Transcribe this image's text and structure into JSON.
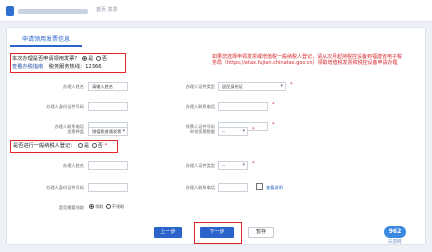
{
  "header": {
    "blurred_site_name": "",
    "subtitle": "首页 发票"
  },
  "tab": {
    "label": "申请领用发票信息"
  },
  "question_local_purchase": {
    "prefix": "本次办理是否申请领用发票？",
    "yes": "是",
    "no": "否",
    "yes_selected": true,
    "blurred_label": "查看办税指南",
    "hotline": "税务服务热线：12366"
  },
  "notice": "如果您选择申领发票或增值税一般纳税人登记，请从次月起持税控设备到福建省电子税务局（https://etax.fujian.chinatax.gov.cn）领取增值税发票和税控设备申请办理",
  "form_top": {
    "row1": {
      "label": "办理人姓名",
      "value": "请输入姓名",
      "label2": "办理人证件类型",
      "value2": "居民身份证"
    },
    "row2": {
      "label": "办理人身份证件号码",
      "label2": "办理人联系电话"
    },
    "row3": {
      "label": "办理人联系电话",
      "label2": "领票人证件号码"
    },
    "row4": {
      "label": "发票种类",
      "value": "增值税普通发票",
      "label2": "申领发票数量",
      "value2": "--"
    }
  },
  "question_general_taxpayer": {
    "prefix": "是否进行一般纳税人登记：",
    "yes": "是",
    "no": "否",
    "no_selected": false
  },
  "form_bottom": {
    "row1": {
      "label": "办理人姓名",
      "label2": "办理人证件类型",
      "value2": "--"
    },
    "row2": {
      "label": "办理人身份证件号码",
      "label2": "办理人联系电话",
      "link": "查看说明"
    },
    "row3": {
      "label": "是否需要领取",
      "option_a": "领取",
      "option_b": "不领取"
    }
  },
  "buttons": {
    "prev": "上一步",
    "next": "下一步",
    "save": "暂存"
  },
  "watermark": {
    "logo": "962",
    "text": "乐游网"
  },
  "colors": {
    "primary": "#2a63c9",
    "highlight": "#e0262b",
    "notice_red": "#d4282c"
  }
}
